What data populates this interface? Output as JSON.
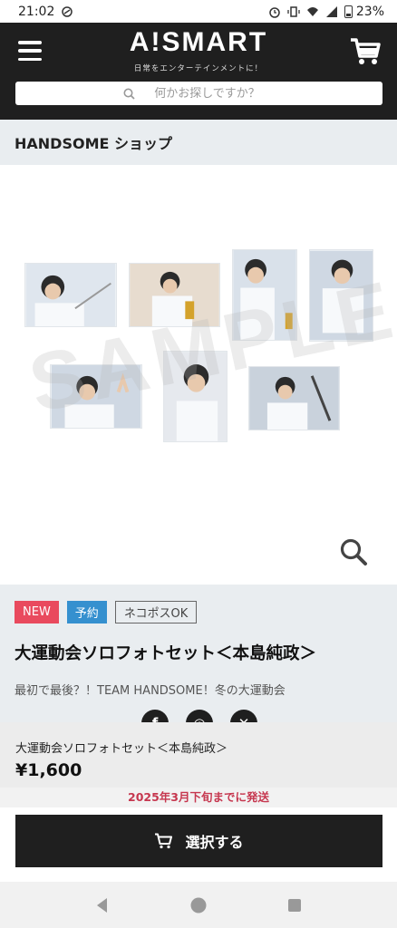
{
  "status_bar": {
    "time": "21:02",
    "battery": "23%"
  },
  "header": {
    "logo": "A!SMART",
    "tagline": "日常をエンターテインメントに！",
    "search_placeholder": "何かお探しですか？",
    "icons": [
      "menu-icon",
      "cart-icon",
      "search-icon"
    ]
  },
  "shop": {
    "title": "HANDSOME ショップ"
  },
  "gallery": {
    "watermark": "SAMPLE",
    "zoom_icon": "zoom-icon"
  },
  "product": {
    "badges": {
      "new": "NEW",
      "preorder": "予約",
      "shipping": "ネコポスOK"
    },
    "title": "大運動会ソロフォトセット＜本島純政＞",
    "subtitle": "最初で最後？！TEAM HANDSOME！冬の大運動会",
    "share": {
      "facebook": "f",
      "instagram": "◎",
      "x": "✕"
    }
  },
  "sticky": {
    "name": "大運動会ソロフォトセット＜本島純政＞",
    "price": "¥1,600",
    "ship_note": "2025年3月下旬までに発送",
    "button_label": "選択する"
  },
  "colors": {
    "header_bg": "#1f1f1f",
    "badge_new": "#e94a5e",
    "badge_pre": "#3590cf",
    "ship_note": "#c6374f"
  }
}
